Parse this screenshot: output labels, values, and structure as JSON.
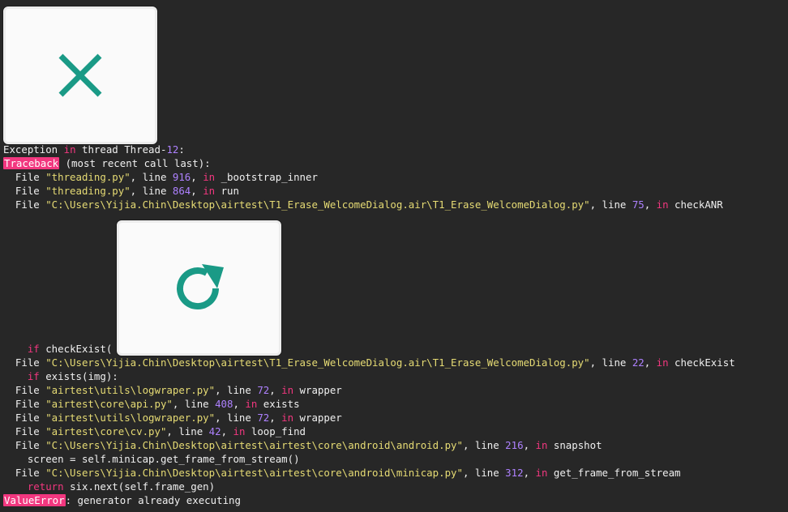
{
  "thumbnails": [
    {
      "icon": "close-icon",
      "color": "#1a9a86"
    },
    {
      "icon": "refresh-icon",
      "color": "#1a9a86"
    }
  ],
  "log": {
    "l1": {
      "a": "Exception ",
      "b": "in",
      "c": " thread Thread-",
      "d": "12",
      "e": ":"
    },
    "l2": {
      "a": "Traceback",
      "b": " (most recent call last):"
    },
    "l3": {
      "a": "  File ",
      "b": "\"threading.py\"",
      "c": ", line ",
      "d": "916",
      "e": ", ",
      "f": "in",
      "g": " _bootstrap_inner"
    },
    "l4": {
      "a": "  File ",
      "b": "\"threading.py\"",
      "c": ", line ",
      "d": "864",
      "e": ", ",
      "f": "in",
      "g": " run"
    },
    "l5": {
      "a": "  File ",
      "b": "\"C:\\Users\\Yijia.Chin\\Desktop\\airtest\\T1_Erase_WelcomeDialog.air\\T1_Erase_WelcomeDialog.py\"",
      "c": ", line ",
      "d": "75",
      "e": ", ",
      "f": "in",
      "g": " checkANR"
    },
    "l6": {
      "a": "    ",
      "b": "if",
      "c": " checkExist(",
      "d": "                         ",
      "e": "):"
    },
    "l7": {
      "a": "  File ",
      "b": "\"C:\\Users\\Yijia.Chin\\Desktop\\airtest\\T1_Erase_WelcomeDialog.air\\T1_Erase_WelcomeDialog.py\"",
      "c": ", line ",
      "d": "22",
      "e": ", ",
      "f": "in",
      "g": " checkExist"
    },
    "l8": {
      "a": "    ",
      "b": "if",
      "c": " exists(img):"
    },
    "l9": {
      "a": "  File ",
      "b": "\"airtest\\utils\\logwraper.py\"",
      "c": ", line ",
      "d": "72",
      "e": ", ",
      "f": "in",
      "g": " wrapper"
    },
    "l10": {
      "a": "  File ",
      "b": "\"airtest\\core\\api.py\"",
      "c": ", line ",
      "d": "408",
      "e": ", ",
      "f": "in",
      "g": " exists"
    },
    "l11": {
      "a": "  File ",
      "b": "\"airtest\\utils\\logwraper.py\"",
      "c": ", line ",
      "d": "72",
      "e": ", ",
      "f": "in",
      "g": " wrapper"
    },
    "l12": {
      "a": "  File ",
      "b": "\"airtest\\core\\cv.py\"",
      "c": ", line ",
      "d": "42",
      "e": ", ",
      "f": "in",
      "g": " loop_find"
    },
    "l13": {
      "a": "  File ",
      "b": "\"C:\\Users\\Yijia.Chin\\Desktop\\airtest\\airtest\\core\\android\\android.py\"",
      "c": ", line ",
      "d": "216",
      "e": ", ",
      "f": "in",
      "g": " snapshot"
    },
    "l14": {
      "a": "    screen = self.minicap.get_frame_from_stream()"
    },
    "l15": {
      "a": "  File ",
      "b": "\"C:\\Users\\Yijia.Chin\\Desktop\\airtest\\airtest\\core\\android\\minicap.py\"",
      "c": ", line ",
      "d": "312",
      "e": ", ",
      "f": "in",
      "g": " get_frame_from_stream"
    },
    "l16": {
      "a": "    ",
      "b": "return",
      "c": " six.next(self.frame_gen)"
    },
    "l17": {
      "a": "ValueError",
      "b": ": generator already executing"
    }
  }
}
